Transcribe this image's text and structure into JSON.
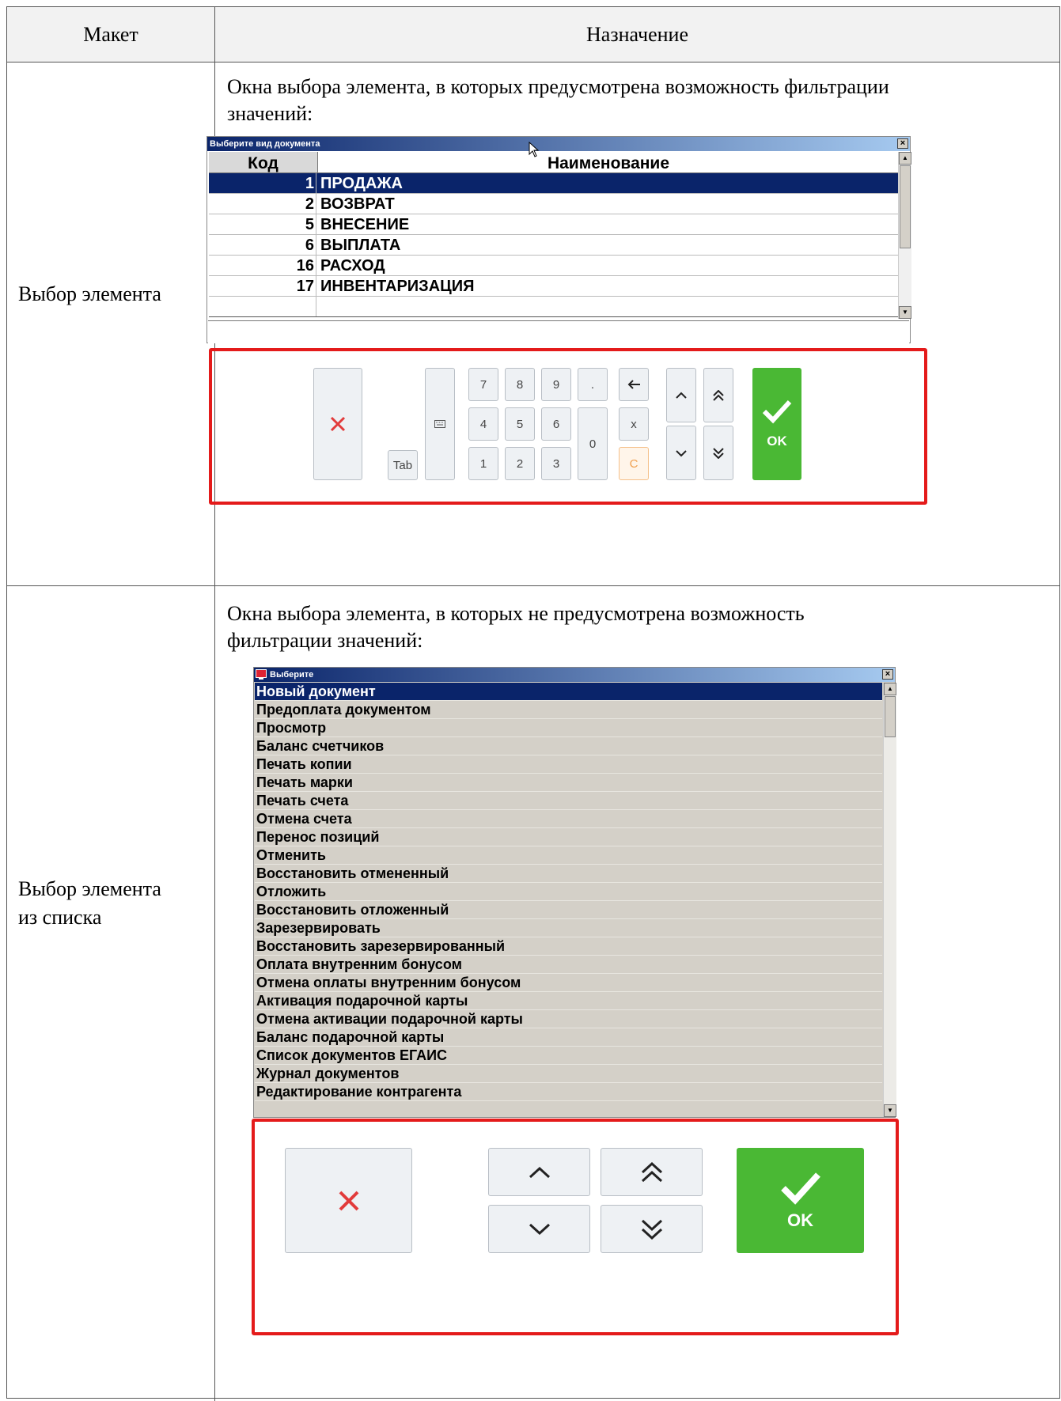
{
  "table": {
    "header": {
      "col1": "Макет",
      "col2": "Назначение"
    }
  },
  "row1": {
    "label": "Выбор элемента",
    "description_line1": "Окна выбора элемента, в которых предусмотрена возможность фильтрации",
    "description_line2": "значений:",
    "window": {
      "title": "Выберите вид документа",
      "close": "×",
      "col_code": "Код",
      "col_name": "Наименование",
      "rows": [
        {
          "code": "1",
          "name": "ПРОДАЖА",
          "selected": true
        },
        {
          "code": "2",
          "name": "ВОЗВРАТ"
        },
        {
          "code": "5",
          "name": "ВНЕСЕНИЕ"
        },
        {
          "code": "6",
          "name": "ВЫПЛАТА"
        },
        {
          "code": "16",
          "name": "РАСХОД"
        },
        {
          "code": "17",
          "name": "ИНВЕНТАРИЗАЦИЯ"
        }
      ]
    },
    "keypad": {
      "tab": "Tab",
      "d7": "7",
      "d8": "8",
      "d9": "9",
      "dot": ".",
      "d4": "4",
      "d5": "5",
      "d6": "6",
      "d1": "1",
      "d2": "2",
      "d3": "3",
      "d0": "0",
      "x": "x",
      "c": "C",
      "ok": "OK"
    }
  },
  "row2": {
    "label_line1": "Выбор элемента",
    "label_line2": "из списка",
    "description_line1": "Окна выбора элемента, в которых не предусмотрена возможность",
    "description_line2": "фильтрации значений:",
    "window": {
      "title": "Выберите",
      "close": "×",
      "items": [
        "Новый документ",
        "Предоплата документом",
        "Просмотр",
        "Баланс счетчиков",
        "Печать копии",
        "Печать марки",
        "Печать счета",
        "Отмена счета",
        "Перенос позиций",
        "Отменить",
        "Восстановить отмененный",
        "Отложить",
        "Восстановить отложенный",
        "Зарезервировать",
        "Восстановить зарезервированный",
        "Оплата внутренним бонусом",
        "Отмена оплаты внутренним бонусом",
        "Активация подарочной карты",
        "Отмена активации подарочной карты",
        "Баланс подарочной карты",
        "Список документов ЕГАИС",
        "Журнал документов",
        "Редактирование контрагента"
      ]
    },
    "keypad": {
      "ok": "OK"
    }
  },
  "colors": {
    "accent_green": "#4ab834",
    "highlight_red": "#e41b1b",
    "selection_navy": "#0a246a"
  }
}
